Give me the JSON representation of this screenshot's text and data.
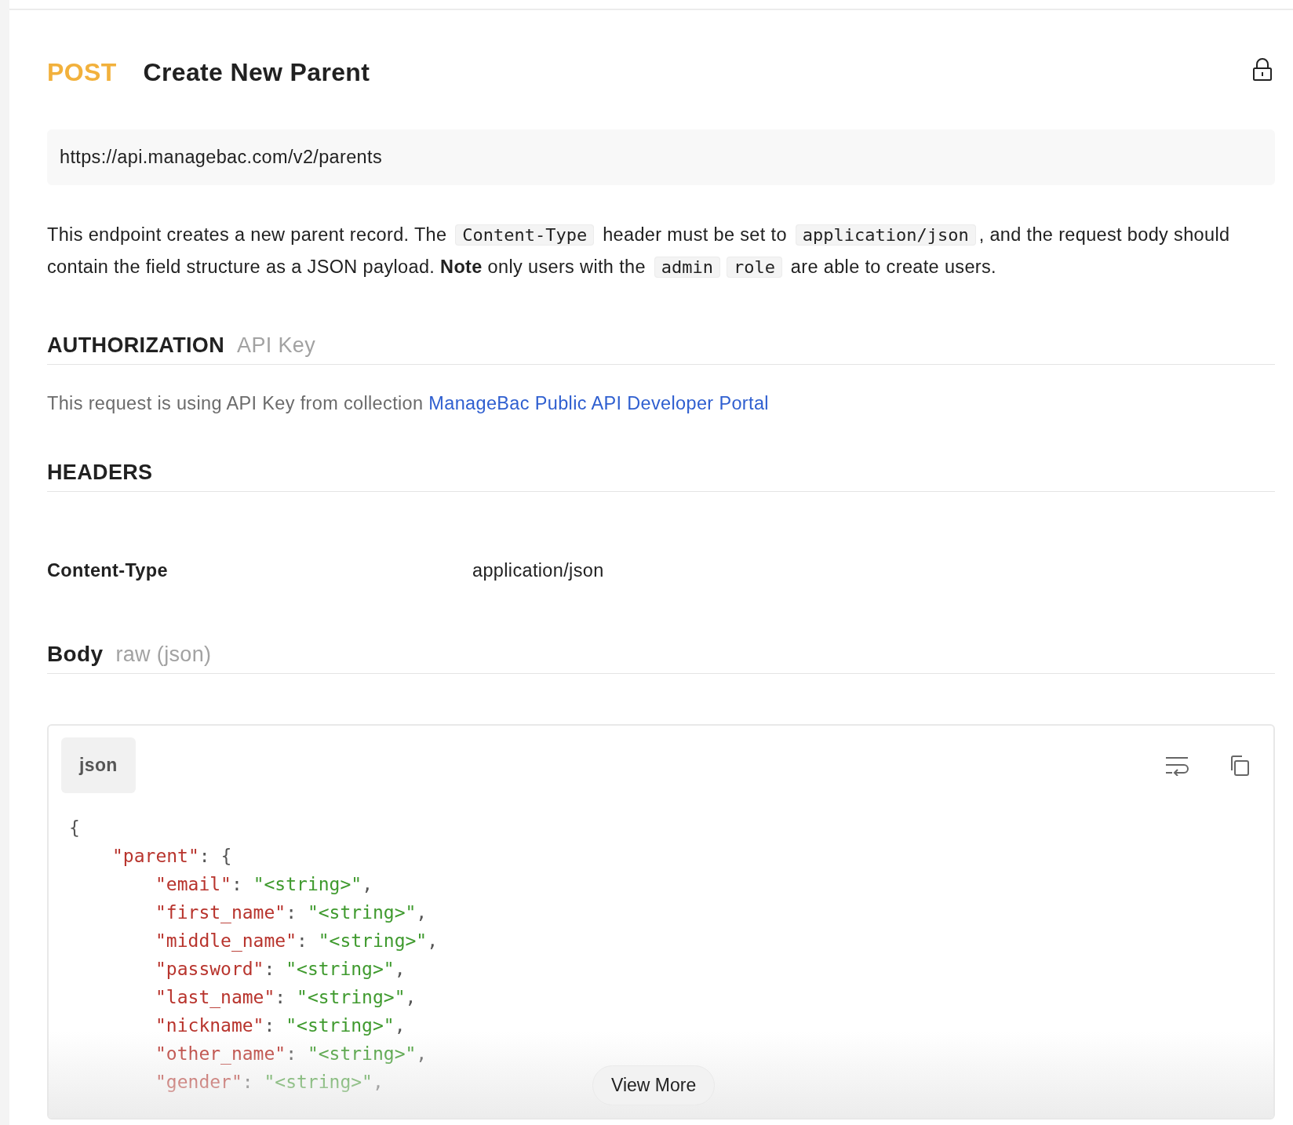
{
  "request": {
    "method": "POST",
    "title": "Create New Parent",
    "url": "https://api.managebac.com/v2/parents"
  },
  "description": [
    {
      "kind": "text",
      "text": "This endpoint creates a new parent record. The "
    },
    {
      "kind": "code",
      "text": "Content-Type"
    },
    {
      "kind": "text",
      "text": " header must be set to "
    },
    {
      "kind": "code",
      "text": "application/json"
    },
    {
      "kind": "text",
      "text": ", and the request body should contain the field structure as a JSON payload. "
    },
    {
      "kind": "bold",
      "text": "Note"
    },
    {
      "kind": "text",
      "text": " only users with the "
    },
    {
      "kind": "code",
      "text": "admin"
    },
    {
      "kind": "code",
      "text": "role"
    },
    {
      "kind": "text",
      "text": " are able to create users."
    }
  ],
  "authorization": {
    "heading": "AUTHORIZATION",
    "type": "API Key",
    "text": "This request is using API Key from collection ",
    "link": "ManageBac Public API Developer Portal"
  },
  "headers": {
    "heading": "HEADERS",
    "rows": [
      {
        "key": "Content-Type",
        "value": "application/json"
      }
    ]
  },
  "body": {
    "heading": "Body",
    "type": "raw (json)",
    "language": "json",
    "view_more": "View More",
    "code": [
      {
        "tokens": [
          {
            "kind": "punct",
            "text": "{"
          }
        ],
        "children": [
          {
            "tokens": [
              {
                "kind": "key",
                "text": "\"parent\""
              },
              {
                "kind": "punct",
                "text": ": {"
              }
            ],
            "children": [
              {
                "tokens": [
                  {
                    "kind": "key",
                    "text": "\"email\""
                  },
                  {
                    "kind": "punct",
                    "text": ": "
                  },
                  {
                    "kind": "string",
                    "text": "\"<string>\""
                  },
                  {
                    "kind": "punct",
                    "text": ","
                  }
                ]
              },
              {
                "tokens": [
                  {
                    "kind": "key",
                    "text": "\"first_name\""
                  },
                  {
                    "kind": "punct",
                    "text": ": "
                  },
                  {
                    "kind": "string",
                    "text": "\"<string>\""
                  },
                  {
                    "kind": "punct",
                    "text": ","
                  }
                ]
              },
              {
                "tokens": [
                  {
                    "kind": "key",
                    "text": "\"middle_name\""
                  },
                  {
                    "kind": "punct",
                    "text": ": "
                  },
                  {
                    "kind": "string",
                    "text": "\"<string>\""
                  },
                  {
                    "kind": "punct",
                    "text": ","
                  }
                ]
              },
              {
                "tokens": [
                  {
                    "kind": "key",
                    "text": "\"password\""
                  },
                  {
                    "kind": "punct",
                    "text": ": "
                  },
                  {
                    "kind": "string",
                    "text": "\"<string>\""
                  },
                  {
                    "kind": "punct",
                    "text": ","
                  }
                ]
              },
              {
                "tokens": [
                  {
                    "kind": "key",
                    "text": "\"last_name\""
                  },
                  {
                    "kind": "punct",
                    "text": ": "
                  },
                  {
                    "kind": "string",
                    "text": "\"<string>\""
                  },
                  {
                    "kind": "punct",
                    "text": ","
                  }
                ]
              },
              {
                "tokens": [
                  {
                    "kind": "key",
                    "text": "\"nickname\""
                  },
                  {
                    "kind": "punct",
                    "text": ": "
                  },
                  {
                    "kind": "string",
                    "text": "\"<string>\""
                  },
                  {
                    "kind": "punct",
                    "text": ","
                  }
                ]
              },
              {
                "tokens": [
                  {
                    "kind": "key",
                    "text": "\"other_name\""
                  },
                  {
                    "kind": "punct",
                    "text": ": "
                  },
                  {
                    "kind": "string",
                    "text": "\"<string>\""
                  },
                  {
                    "kind": "punct",
                    "text": ","
                  }
                ]
              },
              {
                "tokens": [
                  {
                    "kind": "key",
                    "text": "\"gender\""
                  },
                  {
                    "kind": "punct",
                    "text": ": "
                  },
                  {
                    "kind": "string",
                    "text": "\"<string>\""
                  },
                  {
                    "kind": "punct",
                    "text": ","
                  }
                ]
              }
            ]
          }
        ]
      }
    ]
  }
}
